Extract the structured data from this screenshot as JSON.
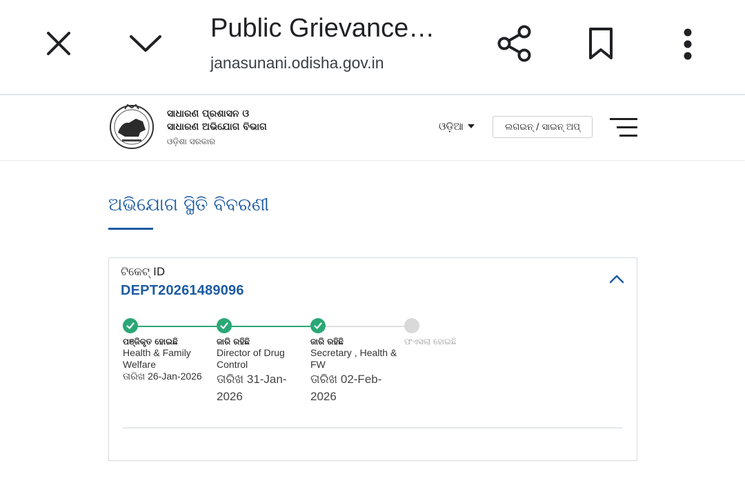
{
  "browser": {
    "title": "Public Grievance…",
    "url": "janasunani.odisha.gov.in"
  },
  "header": {
    "dept_line1": "ସାଧାରଣ ପ୍ରଶାସନ ଓ",
    "dept_line2": "ସାଧାରଣ ଅଭିଯୋଗ ବିଭାଗ",
    "dept_line3": "ଓଡ଼ିଶା ସରକାର",
    "language": "ଓଡ଼ିଆ",
    "login_label": "ଲଗଇନ୍ / ସାଇନ୍ ଅପ୍"
  },
  "page": {
    "title": "ଅଭିଯୋଗ ସ୍ଥିତି ବିବରଣୀ"
  },
  "ticket": {
    "label": "ଟିକେଟ୍ ID",
    "id": "DEPT20261489096"
  },
  "timeline": [
    {
      "status": "ପଞ୍ଜିକୃତ ହୋଇଛି",
      "office": "Health & Family Welfare",
      "date_prefix": "ତାରିଖ",
      "date": "26-Jan-2026",
      "state": "done"
    },
    {
      "status": "ଜାରି ରହିଛି",
      "office": "Director of Drug Control",
      "date_prefix": "ତାରିଖ",
      "date": "31-Jan-2026",
      "state": "done"
    },
    {
      "status": "ଜାରି ରହିଛି",
      "office": "Secretary , Health & FW",
      "date_prefix": "ତାରିଖ",
      "date": "02-Feb-2026",
      "state": "done"
    },
    {
      "status": "ଫଏସଲା ହୋଇଛି",
      "office": "",
      "date_prefix": "",
      "date": "",
      "state": "pending"
    }
  ],
  "colors": {
    "accent": "#1d5ba3",
    "done": "#2aa876",
    "pending": "#d9d9d9"
  },
  "icons": [
    "close-icon",
    "chevron-down-icon",
    "share-icon",
    "bookmark-icon",
    "more-vert-icon",
    "emblem-logo",
    "menu-icon",
    "chevron-up-icon",
    "check-icon"
  ]
}
